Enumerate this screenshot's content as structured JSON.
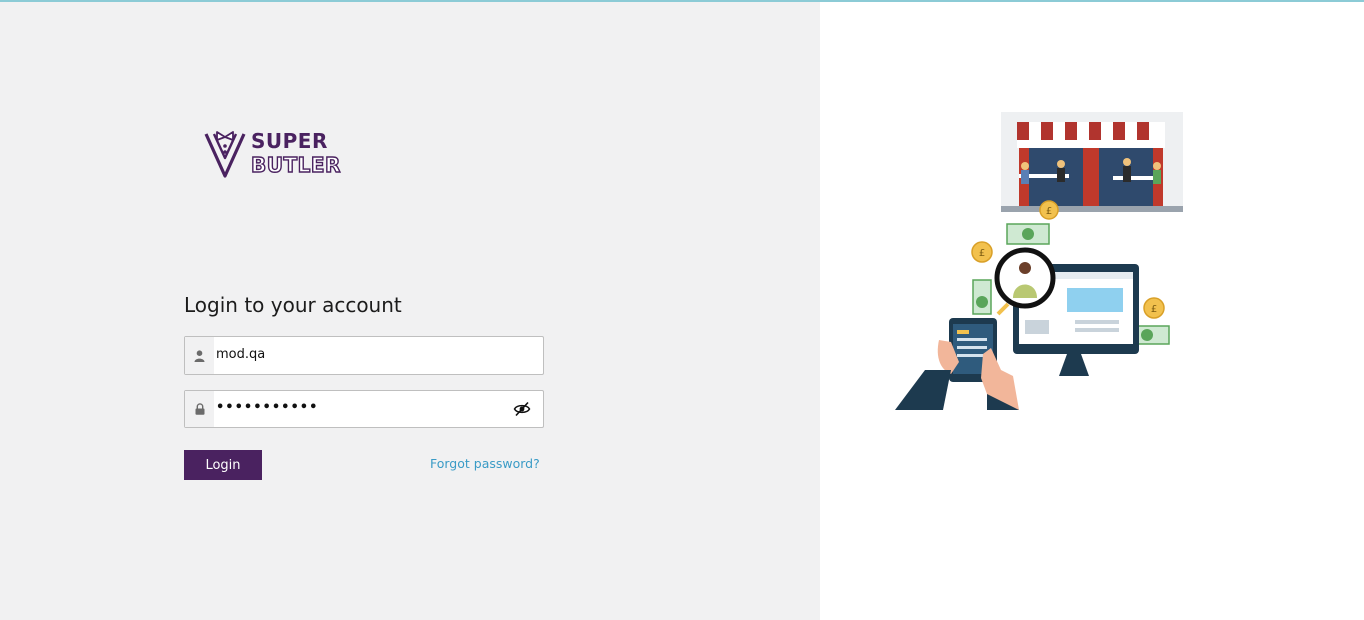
{
  "brand": {
    "name_line1": "SUPER",
    "name_line2": "BUTLER",
    "color": "#4a2260",
    "icon": "butler-logo-icon"
  },
  "login": {
    "title": "Login to your account",
    "username": {
      "value": "mod.qa",
      "icon": "user-icon"
    },
    "password": {
      "masked_value": "•••••••••••",
      "icon": "lock-icon",
      "toggle_icon": "eye-slash-icon"
    },
    "submit_label": "Login",
    "forgot_label": "Forgot password?"
  },
  "colors": {
    "left_bg": "#f1f1f2",
    "button_bg": "#4a2260",
    "link": "#3a9bc6",
    "top_line": "#8ccbd6"
  },
  "illustration": {
    "icon": "restaurant-ordering-illustration",
    "currency_symbol": "£"
  }
}
